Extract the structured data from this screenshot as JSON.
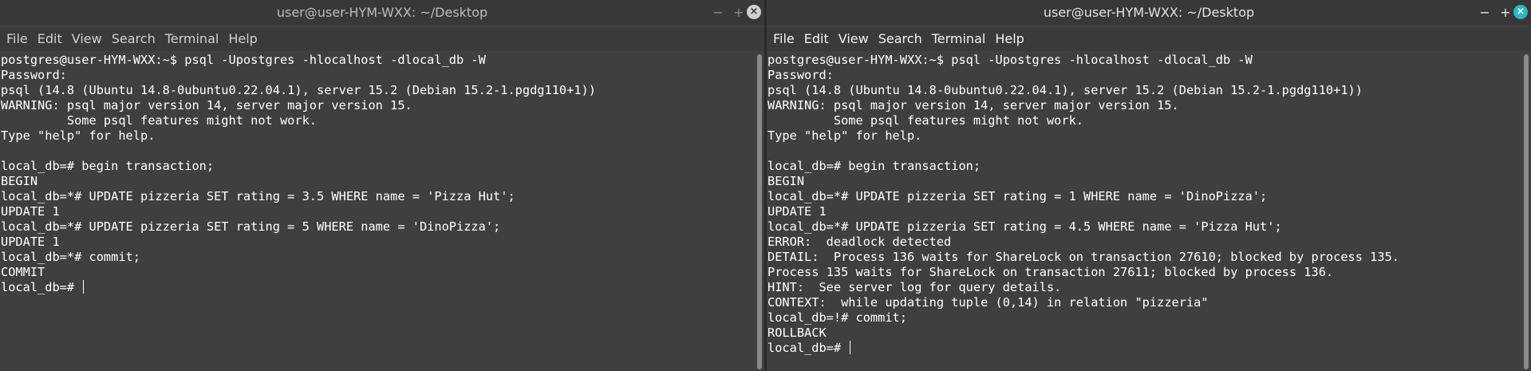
{
  "left": {
    "title": "user@user-HYM-WXX: ~/Desktop",
    "controls": {
      "minimize": "−",
      "maximize": "+",
      "close": "×"
    },
    "menu": [
      "File",
      "Edit",
      "View",
      "Search",
      "Terminal",
      "Help"
    ],
    "lines": [
      "postgres@user-HYM-WXX:~$ psql -Upostgres -hlocalhost -dlocal_db -W",
      "Password:",
      "psql (14.8 (Ubuntu 14.8-0ubuntu0.22.04.1), server 15.2 (Debian 15.2-1.pgdg110+1))",
      "WARNING: psql major version 14, server major version 15.",
      "         Some psql features might not work.",
      "Type \"help\" for help.",
      "",
      "local_db=# begin transaction;",
      "BEGIN",
      "local_db=*# UPDATE pizzeria SET rating = 3.5 WHERE name = 'Pizza Hut';",
      "UPDATE 1",
      "local_db=*# UPDATE pizzeria SET rating = 5 WHERE name = 'DinoPizza';",
      "UPDATE 1",
      "local_db=*# commit;",
      "COMMIT"
    ],
    "prompt": "local_db=# "
  },
  "right": {
    "title": "user@user-HYM-WXX: ~/Desktop",
    "controls": {
      "minimize": "−",
      "maximize": "+",
      "close": "×"
    },
    "menu": [
      "File",
      "Edit",
      "View",
      "Search",
      "Terminal",
      "Help"
    ],
    "lines": [
      "postgres@user-HYM-WXX:~$ psql -Upostgres -hlocalhost -dlocal_db -W",
      "Password:",
      "psql (14.8 (Ubuntu 14.8-0ubuntu0.22.04.1), server 15.2 (Debian 15.2-1.pgdg110+1))",
      "WARNING: psql major version 14, server major version 15.",
      "         Some psql features might not work.",
      "Type \"help\" for help.",
      "",
      "local_db=# begin transaction;",
      "BEGIN",
      "local_db=*# UPDATE pizzeria SET rating = 1 WHERE name = 'DinoPizza';",
      "UPDATE 1",
      "local_db=*# UPDATE pizzeria SET rating = 4.5 WHERE name = 'Pizza Hut';",
      "ERROR:  deadlock detected",
      "DETAIL:  Process 136 waits for ShareLock on transaction 27610; blocked by process 135.",
      "Process 135 waits for ShareLock on transaction 27611; blocked by process 136.",
      "HINT:  See server log for query details.",
      "CONTEXT:  while updating tuple (0,14) in relation \"pizzeria\"",
      "local_db=!# commit;",
      "ROLLBACK"
    ],
    "prompt": "local_db=# "
  },
  "colors": {
    "terminal_bg": "#3f3f3f",
    "terminal_fg": "#ffffff",
    "titlebar_bg": "#383838",
    "close_active": "#2bb6c3"
  }
}
